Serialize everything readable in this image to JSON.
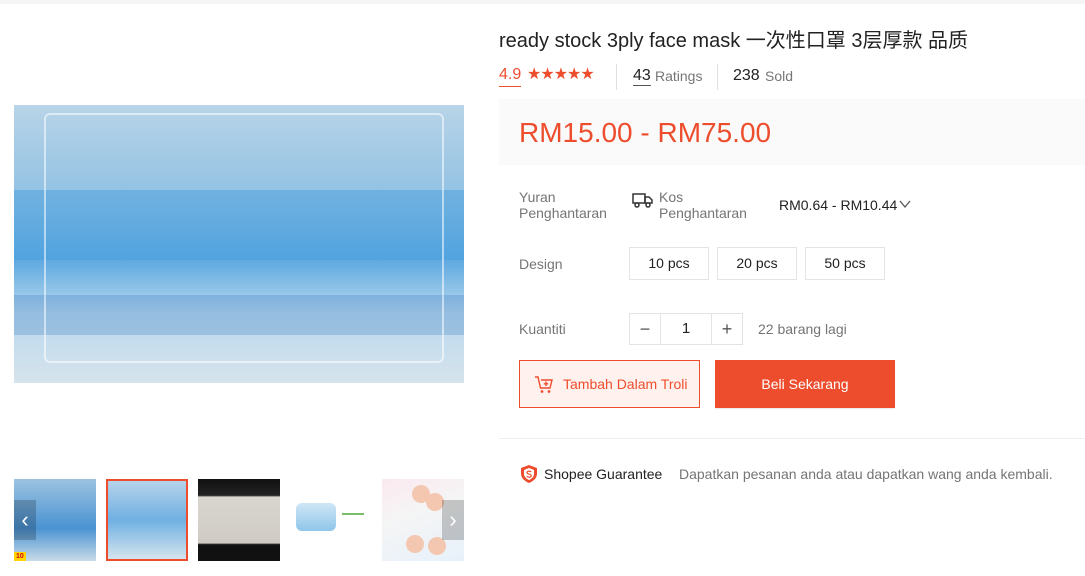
{
  "product": {
    "title": "ready stock 3ply face mask 一次性口罩 3层厚款 品质",
    "rating": "4.9",
    "stars": "★★★★★",
    "ratings_count": "43",
    "ratings_label": "Ratings",
    "sold_count": "238",
    "sold_label": "Sold",
    "price": "RM15.00 - RM75.00"
  },
  "shipping": {
    "label": "Yuran Penghantaran",
    "kos_label": "Kos Penghantaran",
    "price_range": "RM0.64 - RM10.44"
  },
  "design": {
    "label": "Design",
    "options": [
      "10 pcs",
      "20 pcs",
      "50 pcs"
    ]
  },
  "quantity": {
    "label": "Kuantiti",
    "value": "1",
    "minus": "−",
    "plus": "+",
    "stock": "22 barang lagi"
  },
  "actions": {
    "add_to_cart": "Tambah Dalam Troli",
    "buy_now": "Beli Sekarang"
  },
  "guarantee": {
    "title": "Shopee Guarantee",
    "description": "Dapatkan pesanan anda atau dapatkan wang anda kembali."
  },
  "gallery": {
    "prev": "‹",
    "next": "›",
    "badge": "10"
  },
  "colors": {
    "accent": "#ee4d2d",
    "price_bg": "#fafafa"
  }
}
